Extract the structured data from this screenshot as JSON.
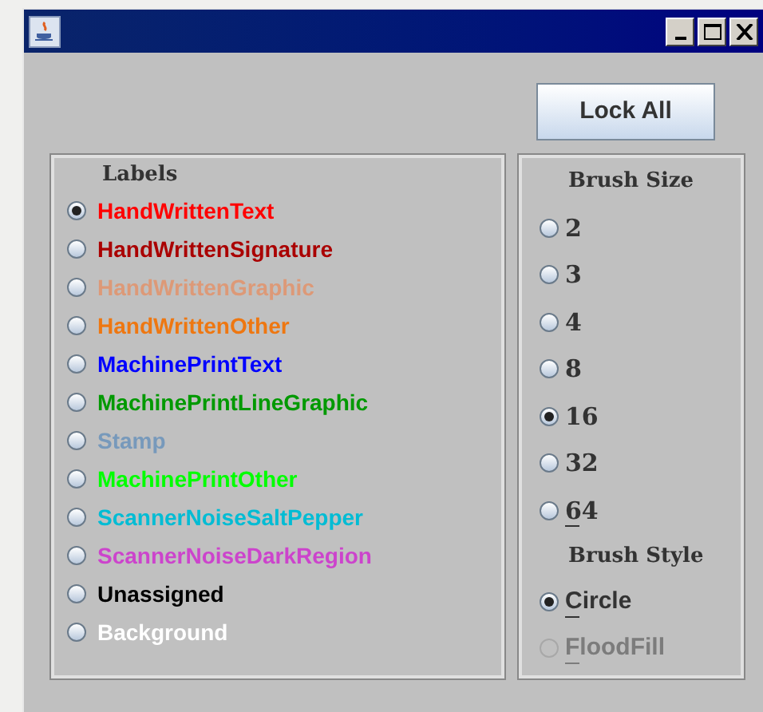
{
  "lock_button": "Lock All",
  "labels": {
    "title": "Labels",
    "items": [
      {
        "label": "HandWrittenText",
        "color": "#ff0000",
        "selected": true
      },
      {
        "label": "HandWrittenSignature",
        "color": "#aa0000",
        "selected": false
      },
      {
        "label": "HandWrittenGraphic",
        "color": "#dd9977",
        "selected": false
      },
      {
        "label": "HandWrittenOther",
        "color": "#ee7711",
        "selected": false
      },
      {
        "label": "MachinePrintText",
        "color": "#0000ff",
        "selected": false
      },
      {
        "label": "MachinePrintLineGraphic",
        "color": "#009900",
        "selected": false
      },
      {
        "label": "Stamp",
        "color": "#7799bb",
        "selected": false
      },
      {
        "label": "MachinePrintOther",
        "color": "#00ff00",
        "selected": false
      },
      {
        "label": "ScannerNoiseSaltPepper",
        "color": "#00bcd4",
        "selected": false
      },
      {
        "label": "ScannerNoiseDarkRegion",
        "color": "#cc44cc",
        "selected": false
      },
      {
        "label": "Unassigned",
        "color": "#000000",
        "selected": false
      },
      {
        "label": "Background",
        "color": "#ffffff",
        "selected": false
      }
    ]
  },
  "brush_size": {
    "title": "Brush Size",
    "items": [
      {
        "label": "2",
        "selected": false,
        "mnemonic": false
      },
      {
        "label": "3",
        "selected": false,
        "mnemonic": false
      },
      {
        "label": "4",
        "selected": false,
        "mnemonic": false
      },
      {
        "label": "8",
        "selected": false,
        "mnemonic": false
      },
      {
        "label": "16",
        "selected": true,
        "mnemonic": false
      },
      {
        "label": "32",
        "selected": false,
        "mnemonic": false
      },
      {
        "label": "64",
        "selected": false,
        "mnemonic": true
      }
    ]
  },
  "brush_style": {
    "title": "Brush Style",
    "items": [
      {
        "label": "Circle",
        "selected": true,
        "mnemonic": true,
        "disabled": false
      },
      {
        "label": "FloodFill",
        "selected": false,
        "mnemonic": true,
        "disabled": true
      }
    ]
  }
}
